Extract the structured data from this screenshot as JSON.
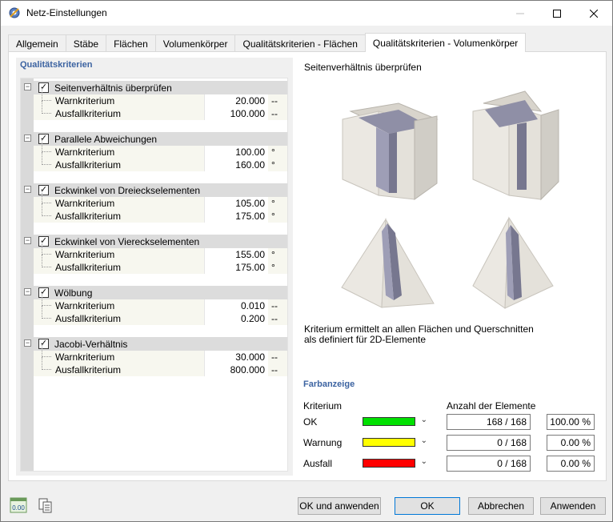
{
  "window": {
    "title": "Netz-Einstellungen"
  },
  "tabs": [
    {
      "label": "Allgemein",
      "active": false
    },
    {
      "label": "Stäbe",
      "active": false
    },
    {
      "label": "Flächen",
      "active": false
    },
    {
      "label": "Volumenkörper",
      "active": false
    },
    {
      "label": "Qualitätskriterien - Flächen",
      "active": false
    },
    {
      "label": "Qualitätskriterien - Volumenkörper",
      "active": true
    }
  ],
  "criteria_group": {
    "title": "Qualitätskriterien",
    "items": [
      {
        "label": "Seitenverhältnis überprüfen",
        "checked": true,
        "warn_label": "Warnkriterium",
        "warn": "20.000",
        "warn_unit": "--",
        "fail_label": "Ausfallkriterium",
        "fail": "100.000",
        "fail_unit": "--"
      },
      {
        "label": "Parallele Abweichungen",
        "checked": true,
        "warn_label": "Warnkriterium",
        "warn": "100.00",
        "warn_unit": "°",
        "fail_label": "Ausfallkriterium",
        "fail": "160.00",
        "fail_unit": "°"
      },
      {
        "label": "Eckwinkel von Dreieckselementen",
        "checked": true,
        "warn_label": "Warnkriterium",
        "warn": "105.00",
        "warn_unit": "°",
        "fail_label": "Ausfallkriterium",
        "fail": "175.00",
        "fail_unit": "°"
      },
      {
        "label": "Eckwinkel von Viereckselementen",
        "checked": true,
        "warn_label": "Warnkriterium",
        "warn": "155.00",
        "warn_unit": "°",
        "fail_label": "Ausfallkriterium",
        "fail": "175.00",
        "fail_unit": "°"
      },
      {
        "label": "Wölbung",
        "checked": true,
        "warn_label": "Warnkriterium",
        "warn": "0.010",
        "warn_unit": "--",
        "fail_label": "Ausfallkriterium",
        "fail": "0.200",
        "fail_unit": "--"
      },
      {
        "label": "Jacobi-Verhältnis",
        "checked": true,
        "warn_label": "Warnkriterium",
        "warn": "30.000",
        "warn_unit": "--",
        "fail_label": "Ausfallkriterium",
        "fail": "800.000",
        "fail_unit": "--"
      }
    ]
  },
  "preview": {
    "title": "Seitenverhältnis überprüfen",
    "description_line1": "Kriterium ermittelt an allen Flächen und Querschnitten",
    "description_line2": "als definiert für 2D-Elemente"
  },
  "color_display": {
    "title": "Farbanzeige",
    "col_criterion": "Kriterium",
    "col_count": "Anzahl der Elemente",
    "rows": [
      {
        "label": "OK",
        "color": "#00e000",
        "count": "168 / 168",
        "percent": "100.00 %"
      },
      {
        "label": "Warnung",
        "color": "#ffff00",
        "count": "0 / 168",
        "percent": "0.00 %"
      },
      {
        "label": "Ausfall",
        "color": "#ff0000",
        "count": "0 / 168",
        "percent": "0.00 %"
      }
    ]
  },
  "buttons": {
    "ok_apply": "OK und anwenden",
    "ok": "OK",
    "cancel": "Abbrechen",
    "apply": "Anwenden"
  },
  "bottom_icons": {
    "units_icon_text": "0.00"
  }
}
